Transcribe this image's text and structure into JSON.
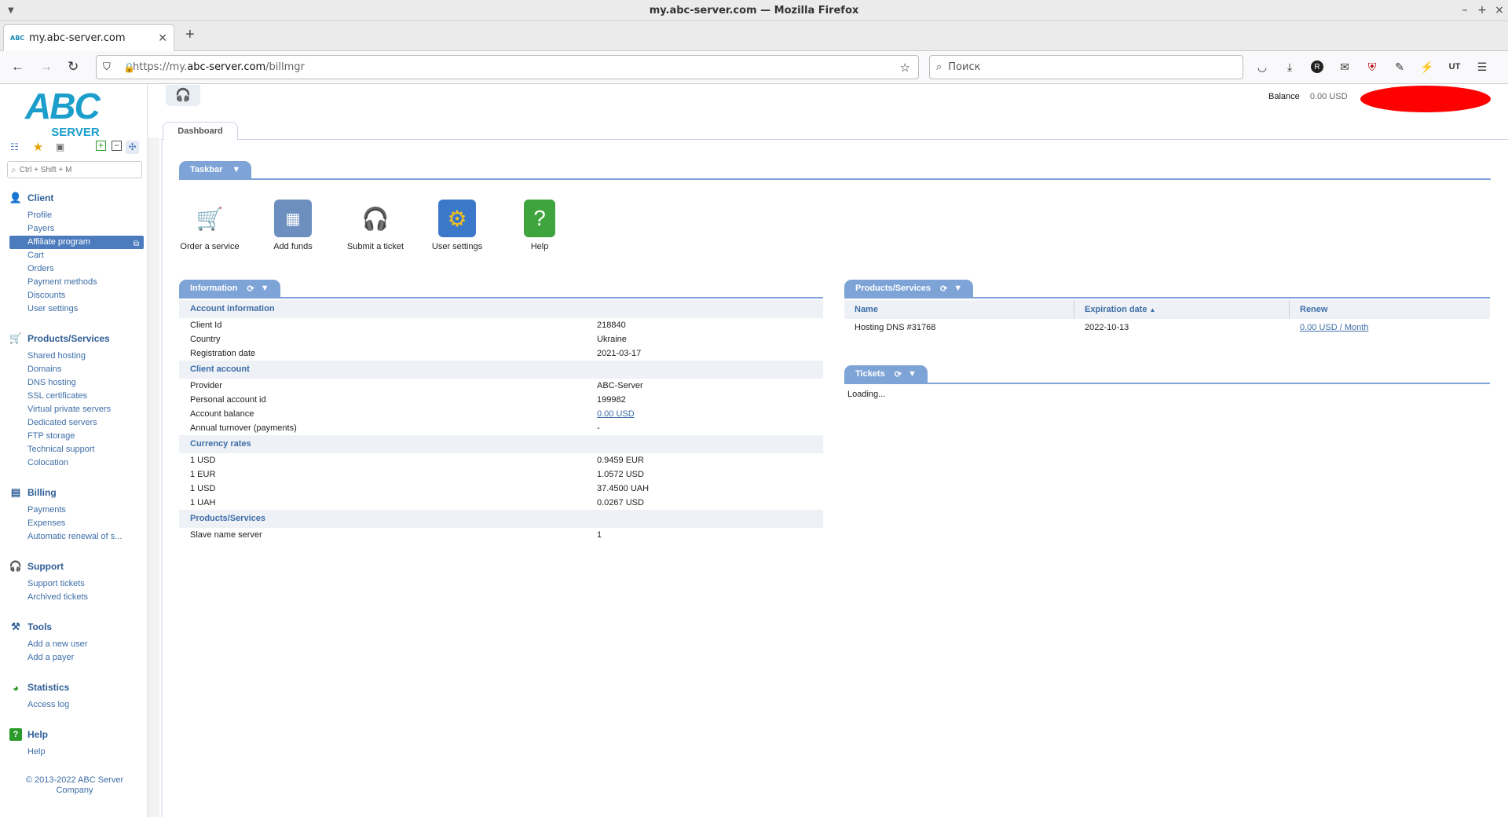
{
  "browser": {
    "window_title": "my.abc-server.com — Mozilla Firefox",
    "tab_title": "my.abc-server.com",
    "url_prefix": "https://my.",
    "url_domain": "abc-server.com",
    "url_path": "/billmgr",
    "search_placeholder": "Поиск"
  },
  "sidebar": {
    "logo_top": "ABC",
    "logo_bottom": "SERVER",
    "search_placeholder": "Ctrl + Shift + M",
    "sections": [
      {
        "title": "Client",
        "icon": "user-icon",
        "items": [
          "Profile",
          "Payers",
          "Affiliate program",
          "Cart",
          "Orders",
          "Payment methods",
          "Discounts",
          "User settings"
        ]
      },
      {
        "title": "Products/Services",
        "icon": "cart-icon",
        "items": [
          "Shared hosting",
          "Domains",
          "DNS hosting",
          "SSL certificates",
          "Virtual private servers",
          "Dedicated servers",
          "FTP storage",
          "Technical support",
          "Colocation"
        ]
      },
      {
        "title": "Billing",
        "icon": "ledger-icon",
        "items": [
          "Payments",
          "Expenses",
          "Automatic renewal of s..."
        ]
      },
      {
        "title": "Support",
        "icon": "headset-icon",
        "items": [
          "Support tickets",
          "Archived tickets"
        ]
      },
      {
        "title": "Tools",
        "icon": "tools-icon",
        "items": [
          "Add a new user",
          "Add a payer"
        ]
      },
      {
        "title": "Statistics",
        "icon": "chart-icon",
        "items": [
          "Access log"
        ]
      },
      {
        "title": "Help",
        "icon": "help-icon",
        "items": [
          "Help"
        ]
      }
    ],
    "copyright": "© 2013-2022 ABC Server Company"
  },
  "header": {
    "balance_label": "Balance",
    "balance_value": "0.00 USD",
    "page_tab": "Dashboard"
  },
  "taskbar": {
    "title": "Taskbar",
    "items": [
      {
        "label": "Order a service",
        "icon": "cart-icon"
      },
      {
        "label": "Add funds",
        "icon": "cash-register-icon"
      },
      {
        "label": "Submit a ticket",
        "icon": "support-agent-icon"
      },
      {
        "label": "User settings",
        "icon": "monitor-gear-icon"
      },
      {
        "label": "Help",
        "icon": "help-book-icon"
      }
    ]
  },
  "information": {
    "title": "Information",
    "groups": [
      {
        "title": "Account information",
        "rows": [
          [
            "Client Id",
            "218840"
          ],
          [
            "Country",
            "Ukraine"
          ],
          [
            "Registration date",
            "2021-03-17"
          ]
        ]
      },
      {
        "title": "Client account",
        "rows": [
          [
            "Provider",
            "ABC-Server"
          ],
          [
            "Personal account id",
            "199982"
          ],
          [
            "Account balance",
            "0.00 USD"
          ],
          [
            "Annual turnover (payments)",
            "-"
          ]
        ]
      },
      {
        "title": "Currency rates",
        "rows": [
          [
            "1 USD",
            "0.9459 EUR"
          ],
          [
            "1 EUR",
            "1.0572 USD"
          ],
          [
            "1 USD",
            "37.4500 UAH"
          ],
          [
            "1 UAH",
            "0.0267 USD"
          ]
        ]
      },
      {
        "title": "Products/Services",
        "rows": [
          [
            "Slave name server",
            "1"
          ]
        ]
      }
    ]
  },
  "products": {
    "title": "Products/Services",
    "columns": [
      "Name",
      "Expiration date",
      "Renew"
    ],
    "rows": [
      [
        "Hosting DNS #31768",
        "2022-10-13",
        "0.00 USD / Month"
      ]
    ]
  },
  "tickets": {
    "title": "Tickets",
    "status": "Loading..."
  }
}
